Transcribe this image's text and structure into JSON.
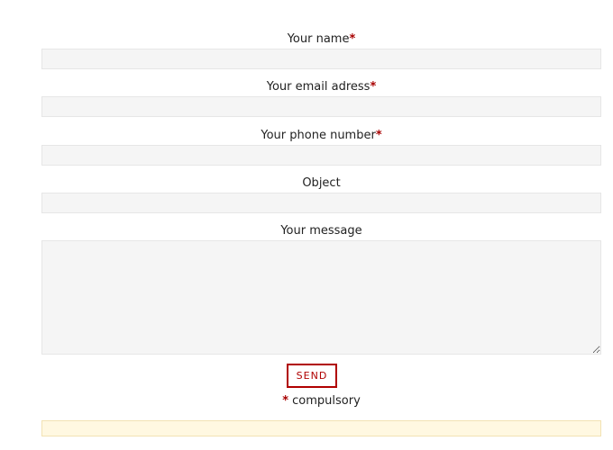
{
  "form": {
    "required_marker": "*",
    "fields": [
      {
        "label": "Your name",
        "required": true,
        "value": ""
      },
      {
        "label": "Your email adress",
        "required": true,
        "value": ""
      },
      {
        "label": "Your phone number",
        "required": true,
        "value": ""
      },
      {
        "label": "Object",
        "required": false,
        "value": ""
      },
      {
        "label": "Your message",
        "required": false,
        "value": ""
      }
    ],
    "send_label": "SEND",
    "compulsory_marker": "*",
    "compulsory_text": "compulsory"
  },
  "colors": {
    "accent": "#a80000",
    "field_bg": "#f5f5f5",
    "field_border": "#e6e6e6",
    "message_bg": "#fff8e1"
  }
}
